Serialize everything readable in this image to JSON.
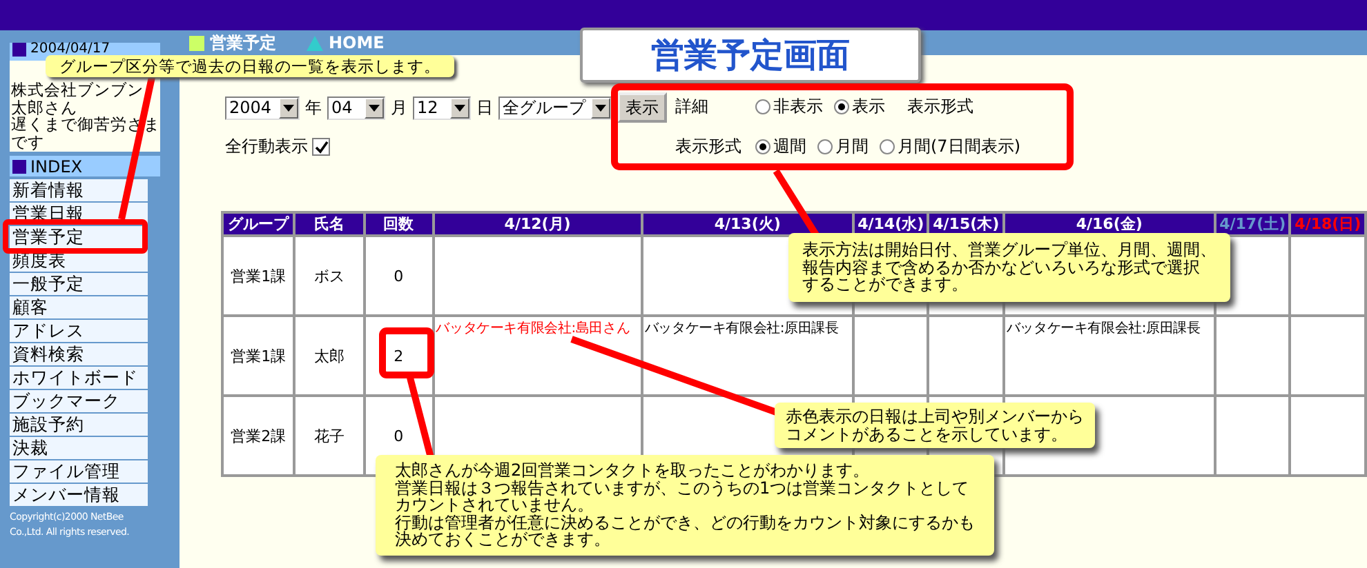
{
  "sidebar": {
    "date": "2004/04/17",
    "user_lines": [
      "株式会社ブンブン",
      "太郎さん",
      "遅くまで御苦労さま",
      "です"
    ],
    "index_title": "INDEX",
    "items": [
      {
        "label": "新着情報"
      },
      {
        "label": "営業日報"
      },
      {
        "label": "営業予定"
      },
      {
        "label": "頻度表"
      },
      {
        "label": "一般予定"
      },
      {
        "label": "顧客"
      },
      {
        "label": "アドレス"
      },
      {
        "label": "資料検索"
      },
      {
        "label": "ホワイトボード"
      },
      {
        "label": "ブックマーク"
      },
      {
        "label": "施設予約"
      },
      {
        "label": "決裁"
      },
      {
        "label": "ファイル管理"
      },
      {
        "label": "メンバー情報"
      }
    ],
    "copyright": [
      "Copyright(c)2000 NetBee",
      "Co.,Ltd. All rights reserved."
    ]
  },
  "nav": {
    "current": "営業予定",
    "home": "HOME"
  },
  "title_box": "営業予定画面",
  "filters": {
    "year": "2004",
    "year_unit": "年",
    "month": "04",
    "month_unit": "月",
    "day": "12",
    "day_unit": "日",
    "group": "全グループ",
    "submit": "表示",
    "all_actions": {
      "label": "全行動表示",
      "checked": true
    }
  },
  "options": {
    "detail": {
      "label": "詳細",
      "choices": [
        {
          "label": "非表示",
          "selected": false
        },
        {
          "label": "表示",
          "selected": true
        }
      ],
      "note": "表示形式"
    },
    "format": {
      "label": "表示形式",
      "choices": [
        {
          "label": "週間",
          "selected": true
        },
        {
          "label": "月間",
          "selected": false
        },
        {
          "label": "月間(7日間表示)",
          "selected": false
        }
      ]
    }
  },
  "table": {
    "columns": [
      "グループ",
      "氏名",
      "回数"
    ],
    "days": [
      {
        "label": "4/12(月)",
        "kind": "weekday"
      },
      {
        "label": "4/13(火)",
        "kind": "weekday"
      },
      {
        "label": "4/14(水)",
        "kind": "weekday"
      },
      {
        "label": "4/15(木)",
        "kind": "weekday"
      },
      {
        "label": "4/16(金)",
        "kind": "weekday"
      },
      {
        "label": "4/17(土)",
        "kind": "saturday"
      },
      {
        "label": "4/18(日)",
        "kind": "sunday"
      }
    ],
    "rows": [
      {
        "group": "営業1課",
        "name": "ボス",
        "count": "0",
        "days": [
          {
            "kind": "empty"
          },
          {
            "kind": "empty"
          },
          {
            "kind": "empty"
          },
          {
            "kind": "empty"
          },
          {
            "kind": "empty"
          },
          {
            "kind": "empty"
          },
          {
            "kind": "empty"
          }
        ]
      },
      {
        "group": "営業1課",
        "name": "太郎",
        "count": "2",
        "days": [
          {
            "kind": "entry",
            "text": "バッタケーキ有限会社:島田さん",
            "commented": true
          },
          {
            "kind": "entry",
            "text": "バッタケーキ有限会社:原田課長",
            "commented": false
          },
          {
            "kind": "empty"
          },
          {
            "kind": "empty"
          },
          {
            "kind": "entry",
            "text": "バッタケーキ有限会社:原田課長",
            "commented": false
          },
          {
            "kind": "empty"
          },
          {
            "kind": "empty"
          }
        ]
      },
      {
        "group": "営業2課",
        "name": "花子",
        "count": "0",
        "days": [
          {
            "kind": "empty"
          },
          {
            "kind": "empty"
          },
          {
            "kind": "empty"
          },
          {
            "kind": "empty"
          },
          {
            "kind": "empty"
          },
          {
            "kind": "empty"
          },
          {
            "kind": "empty"
          }
        ]
      }
    ]
  },
  "callouts": [
    {
      "lines": [
        "グループ区分等で過去の日報の一覧を表示します。"
      ]
    },
    {
      "lines": [
        "表示方法は開始日付、営業グループ単位、月間、週間、",
        "報告内容まで含めるか否かなどいろいろな形式で選択",
        "することができます。"
      ]
    },
    {
      "lines": [
        "赤色表示の日報は上司や別メンバーから",
        "コメントがあることを示しています。"
      ]
    },
    {
      "lines": [
        "太郎さんが今週2回営業コンタクトを取ったことがわかります。",
        "営業日報は３つ報告されていますが、このうちの1つは営業コンタクトとして",
        "カウントされていません。",
        "行動は管理者が任意に決めることができ、どの行動をカウント対象にするかも",
        "決めておくことができます。"
      ]
    }
  ]
}
